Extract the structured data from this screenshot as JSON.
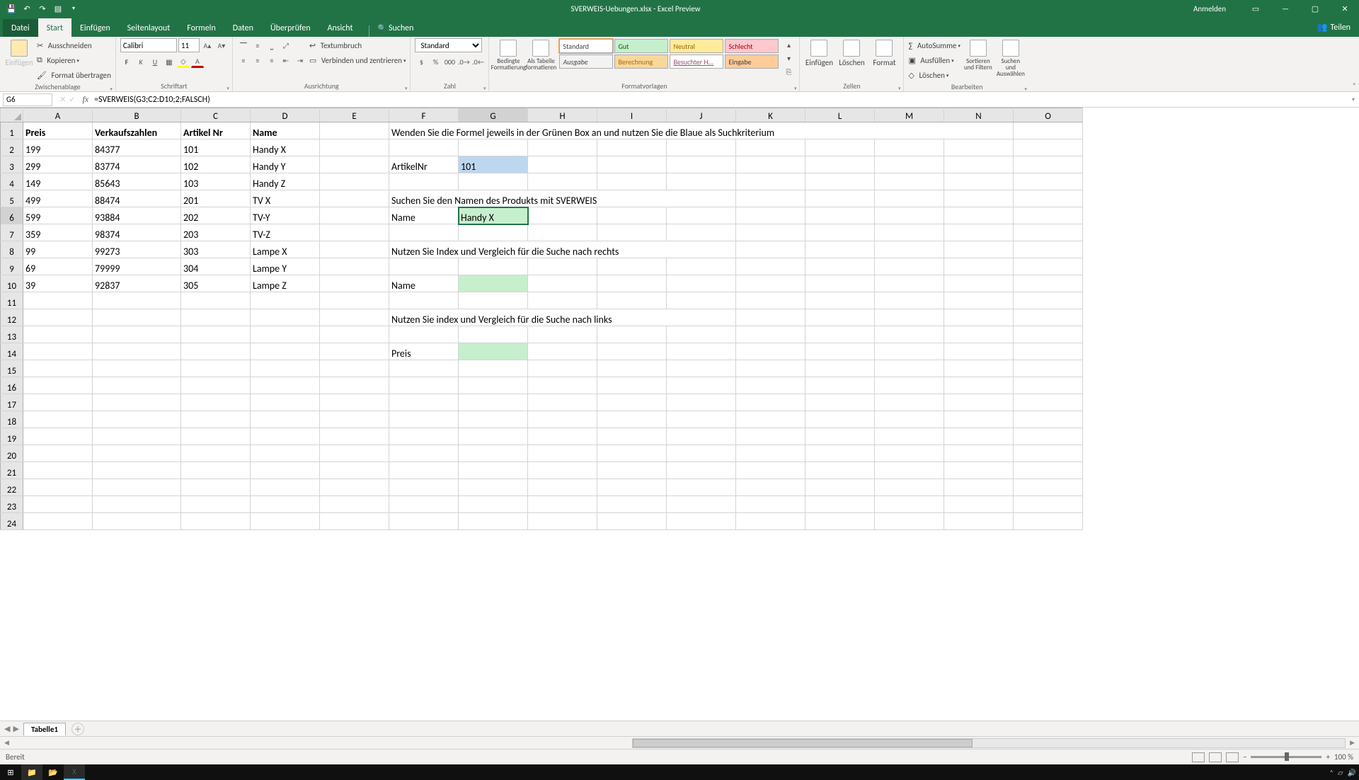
{
  "window": {
    "title": "SVERWEIS-Uebungen.xlsx - Excel Preview",
    "signin": "Anmelden"
  },
  "tabs": {
    "datei": "Datei",
    "start": "Start",
    "einfuegen": "Einfügen",
    "seitenlayout": "Seitenlayout",
    "formeln": "Formeln",
    "daten": "Daten",
    "ueberpruefen": "Überprüfen",
    "ansicht": "Ansicht",
    "suchen": "Suchen",
    "teilen": "Teilen"
  },
  "ribbon": {
    "clipboard": {
      "einfuegen": "Einfügen",
      "ausschneiden": "Ausschneiden",
      "kopieren": "Kopieren",
      "format_uebertragen": "Format übertragen",
      "label": "Zwischenablage"
    },
    "font": {
      "name": "Calibri",
      "size": "11",
      "label": "Schriftart"
    },
    "align": {
      "textumbruch": "Textumbruch",
      "verbinden": "Verbinden und zentrieren",
      "label": "Ausrichtung"
    },
    "number": {
      "format": "Standard",
      "label": "Zahl"
    },
    "styles": {
      "bedingte": "Bedingte Formatierung",
      "als_tabelle": "Als Tabelle formatieren",
      "standard": "Standard",
      "gut": "Gut",
      "neutral": "Neutral",
      "schlecht": "Schlecht",
      "ausgabe": "Ausgabe",
      "berechnung": "Berechnung",
      "besuchter": "Besuchter H...",
      "eingabe": "Eingabe",
      "label": "Formatvorlagen"
    },
    "cells": {
      "einfuegen": "Einfügen",
      "loeschen": "Löschen",
      "format": "Format",
      "label": "Zellen"
    },
    "editing": {
      "autosumme": "AutoSumme",
      "ausfuellen": "Ausfüllen",
      "loeschen": "Löschen",
      "sortieren": "Sortieren und Filtern",
      "suchen": "Suchen und Auswählen",
      "label": "Bearbeiten"
    }
  },
  "formula_bar": {
    "cell_ref": "G6",
    "formula": "=SVERWEIS(G3;C2:D10;2;FALSCH)"
  },
  "columns": [
    "A",
    "B",
    "C",
    "D",
    "E",
    "F",
    "G",
    "H",
    "I",
    "J",
    "K",
    "L",
    "M",
    "N",
    "O"
  ],
  "data": {
    "headers": {
      "A": "Preis",
      "B": "Verkaufszahlen",
      "C": "Artikel Nr",
      "D": "Name"
    },
    "rows": [
      {
        "A": "199",
        "B": "84377",
        "C": "101",
        "D": "Handy X"
      },
      {
        "A": "299",
        "B": "83774",
        "C": "102",
        "D": "Handy Y"
      },
      {
        "A": "149",
        "B": "85643",
        "C": "103",
        "D": "Handy Z"
      },
      {
        "A": "499",
        "B": "88474",
        "C": "201",
        "D": "TV X"
      },
      {
        "A": "599",
        "B": "93884",
        "C": "202",
        "D": "TV-Y"
      },
      {
        "A": "359",
        "B": "98374",
        "C": "203",
        "D": "TV-Z"
      },
      {
        "A": "99",
        "B": "99273",
        "C": "303",
        "D": "Lampe X"
      },
      {
        "A": "69",
        "B": "79999",
        "C": "304",
        "D": "Lampe Y"
      },
      {
        "A": "39",
        "B": "92837",
        "C": "305",
        "D": "Lampe Z"
      }
    ],
    "F1": "Wenden Sie die Formel jeweils in der Grünen Box an und nutzen Sie die Blaue als Suchkriterium",
    "F3": "ArtikelNr",
    "G3": "101",
    "F5": "Suchen Sie den Namen des Produkts mit SVERWEIS",
    "F6": "Name",
    "G6": "Handy X",
    "F8": "Nutzen Sie Index und Vergleich für die Suche nach rechts",
    "F10": "Name",
    "F12": "Nutzen Sie index und Vergleich für die Suche nach links",
    "F14": "Preis"
  },
  "sheet_tab": "Tabelle1",
  "statusbar": {
    "ready": "Bereit",
    "zoom": "100 %"
  },
  "chart_data": {
    "type": "table",
    "title": "Produkt-Daten für SVERWEIS-Übung",
    "columns": [
      "Preis",
      "Verkaufszahlen",
      "Artikel Nr",
      "Name"
    ],
    "rows": [
      [
        199,
        84377,
        101,
        "Handy X"
      ],
      [
        299,
        83774,
        102,
        "Handy Y"
      ],
      [
        149,
        85643,
        103,
        "Handy Z"
      ],
      [
        499,
        88474,
        201,
        "TV X"
      ],
      [
        599,
        93884,
        202,
        "TV-Y"
      ],
      [
        359,
        98374,
        203,
        "TV-Z"
      ],
      [
        99,
        99273,
        303,
        "Lampe X"
      ],
      [
        69,
        79999,
        304,
        "Lampe Y"
      ],
      [
        39,
        92837,
        305,
        "Lampe Z"
      ]
    ],
    "lookup": {
      "ArtikelNr": 101,
      "result_name": "Handy X"
    }
  }
}
